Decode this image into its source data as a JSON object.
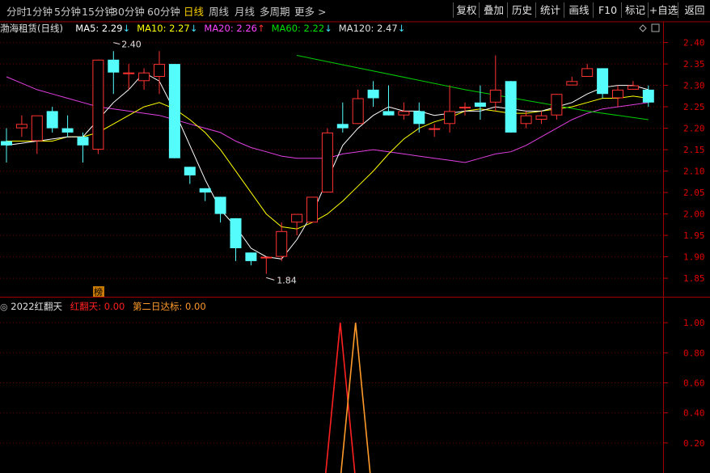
{
  "toolbar": {
    "periods": [
      "分时",
      "1分钟",
      "5分钟",
      "15分钟",
      "30分钟",
      "60分钟",
      "日线",
      "周线",
      "月线",
      "多周期",
      "更多 >"
    ],
    "active_period": "日线",
    "buttons": [
      "复权",
      "叠加",
      "历史",
      "统计",
      "画线",
      "F10",
      "标记",
      "+自选",
      "返回"
    ]
  },
  "legend": {
    "name": "渤海租赁(日线)",
    "items": [
      {
        "label": "MA5: 2.29",
        "arrow": "↓",
        "color": "#ffffff"
      },
      {
        "label": "MA10: 2.27",
        "arrow": "↓",
        "color": "#ffff00"
      },
      {
        "label": "MA20: 2.26",
        "arrow": "↑",
        "color": "#ff44ff"
      },
      {
        "label": "MA60: 2.22",
        "arrow": "↓",
        "color": "#00e000"
      },
      {
        "label": "MA120: 2.47",
        "arrow": "↓",
        "color": "#e0e0e0"
      }
    ],
    "colors": {
      "up": "#ff3232",
      "down": "#54fcfc",
      "ma5": "#ffffff",
      "ma10": "#ffff00",
      "ma20": "#e040e0",
      "ma60": "#00d000"
    }
  },
  "indicator_legend": {
    "name": "2022红翻天",
    "red_label": "红翻天: 0.00",
    "orange_label": "第二日达标: 0.00",
    "red_color": "#ff2020",
    "orange_color": "#ff9a2a"
  },
  "bang_label": "榜",
  "chart_data": [
    {
      "type": "candlestick",
      "ylim": [
        1.82,
        2.42
      ],
      "y_ticks": [
        "2.40",
        "2.35",
        "2.30",
        "2.25",
        "2.20",
        "2.15",
        "2.10",
        "2.05",
        "2.00",
        "1.95",
        "1.90",
        "1.85"
      ],
      "annotations": [
        {
          "text": "2.40",
          "index": 7,
          "value": 2.4
        },
        {
          "text": "1.84",
          "index": 17,
          "value": 1.84
        }
      ],
      "candles": [
        [
          2.17,
          2.2,
          2.16,
          2.12
        ],
        [
          2.2,
          2.23,
          2.21,
          2.18
        ],
        [
          2.17,
          2.23,
          2.23,
          2.14
        ],
        [
          2.24,
          2.25,
          2.2,
          2.19
        ],
        [
          2.2,
          2.23,
          2.19,
          2.18
        ],
        [
          2.18,
          2.19,
          2.16,
          2.12
        ],
        [
          2.15,
          2.36,
          2.36,
          2.14
        ],
        [
          2.36,
          2.38,
          2.33,
          2.28
        ],
        [
          2.33,
          2.35,
          2.33,
          2.29
        ],
        [
          2.31,
          2.34,
          2.33,
          2.29
        ],
        [
          2.32,
          2.38,
          2.35,
          2.28
        ],
        [
          2.35,
          2.35,
          2.13,
          2.13
        ],
        [
          2.11,
          2.11,
          2.09,
          2.07
        ],
        [
          2.06,
          2.06,
          2.05,
          2.03
        ],
        [
          2.04,
          2.04,
          2.0,
          1.98
        ],
        [
          1.99,
          1.99,
          1.92,
          1.89
        ],
        [
          1.91,
          1.91,
          1.89,
          1.88
        ],
        [
          1.9,
          1.9,
          1.9,
          1.86
        ],
        [
          1.9,
          1.98,
          1.96,
          1.89
        ],
        [
          1.98,
          1.99,
          2.0,
          1.95
        ],
        [
          1.98,
          2.04,
          2.04,
          1.98
        ],
        [
          2.05,
          2.2,
          2.19,
          2.05
        ],
        [
          2.21,
          2.26,
          2.2,
          2.19
        ],
        [
          2.21,
          2.29,
          2.27,
          2.21
        ],
        [
          2.29,
          2.31,
          2.27,
          2.25
        ],
        [
          2.24,
          2.3,
          2.23,
          2.23
        ],
        [
          2.23,
          2.26,
          2.24,
          2.22
        ],
        [
          2.24,
          2.26,
          2.21,
          2.19
        ],
        [
          2.2,
          2.21,
          2.2,
          2.18
        ],
        [
          2.21,
          2.3,
          2.24,
          2.19
        ],
        [
          2.25,
          2.26,
          2.25,
          2.23
        ],
        [
          2.26,
          2.3,
          2.25,
          2.22
        ],
        [
          2.26,
          2.37,
          2.29,
          2.24
        ],
        [
          2.31,
          2.31,
          2.19,
          2.19
        ],
        [
          2.21,
          2.24,
          2.23,
          2.2
        ],
        [
          2.22,
          2.24,
          2.23,
          2.21
        ],
        [
          2.23,
          2.28,
          2.28,
          2.22
        ],
        [
          2.3,
          2.32,
          2.31,
          2.3
        ],
        [
          2.32,
          2.35,
          2.34,
          2.32
        ],
        [
          2.34,
          2.34,
          2.28,
          2.27
        ],
        [
          2.27,
          2.3,
          2.29,
          2.25
        ],
        [
          2.29,
          2.31,
          2.3,
          2.29
        ],
        [
          2.29,
          2.3,
          2.26,
          2.25
        ]
      ],
      "ma5": [
        2.16,
        2.165,
        2.17,
        2.175,
        2.18,
        2.18,
        2.22,
        2.26,
        2.29,
        2.33,
        2.31,
        2.24,
        2.16,
        2.08,
        2.01,
        1.97,
        1.92,
        1.9,
        1.895,
        1.94,
        2.0,
        2.08,
        2.16,
        2.2,
        2.23,
        2.25,
        2.24,
        2.24,
        2.23,
        2.235,
        2.24,
        2.24,
        2.25,
        2.245,
        2.24,
        2.24,
        2.25,
        2.26,
        2.28,
        2.295,
        2.3,
        2.3,
        2.29
      ],
      "ma10": [
        2.17,
        2.17,
        2.17,
        2.17,
        2.18,
        2.18,
        2.19,
        2.21,
        2.23,
        2.25,
        2.26,
        2.245,
        2.22,
        2.19,
        2.15,
        2.1,
        2.05,
        2.0,
        1.97,
        1.965,
        1.98,
        2.0,
        2.03,
        2.065,
        2.1,
        2.14,
        2.175,
        2.2,
        2.215,
        2.225,
        2.24,
        2.245,
        2.24,
        2.235,
        2.235,
        2.24,
        2.245,
        2.25,
        2.26,
        2.27,
        2.27,
        2.275,
        2.27
      ],
      "ma20": [
        2.32,
        2.305,
        2.29,
        2.28,
        2.27,
        2.26,
        2.25,
        2.245,
        2.24,
        2.235,
        2.23,
        2.22,
        2.21,
        2.2,
        2.19,
        2.17,
        2.155,
        2.145,
        2.135,
        2.13,
        2.13,
        2.13,
        2.14,
        2.145,
        2.15,
        2.145,
        2.14,
        2.135,
        2.13,
        2.125,
        2.12,
        2.13,
        2.14,
        2.145,
        2.16,
        2.18,
        2.2,
        2.22,
        2.235,
        2.245,
        2.25,
        2.255,
        2.26
      ],
      "ma60": [
        [
          19,
          2.37
        ],
        [
          30,
          2.29
        ],
        [
          38,
          2.24
        ],
        [
          42,
          2.22
        ]
      ]
    },
    {
      "type": "line",
      "ylim": [
        0,
        1.06
      ],
      "y_ticks": [
        "1.00",
        "0.80",
        "0.60",
        "0.40",
        "0.20"
      ],
      "series": [
        {
          "name": "红翻天",
          "peak_index": 22,
          "value": 1.0
        },
        {
          "name": "第二日达标",
          "peak_index": 23,
          "value": 1.0
        }
      ]
    }
  ]
}
